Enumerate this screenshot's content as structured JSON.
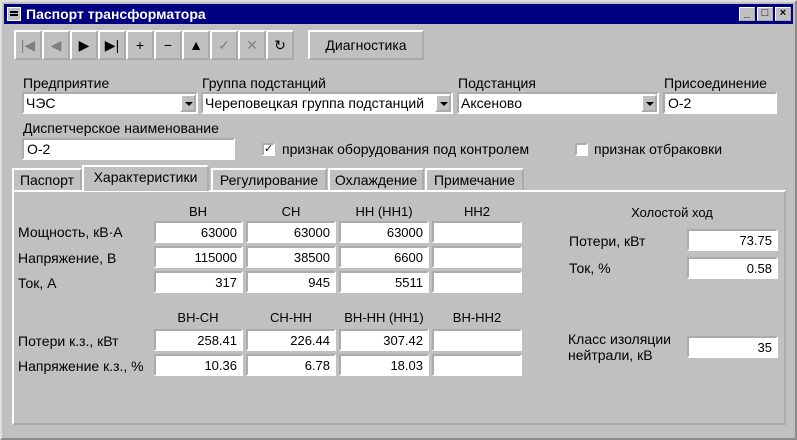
{
  "window": {
    "title": "Паспорт трансформатора"
  },
  "toolbar": {
    "first": "|◀",
    "prev": "◀",
    "next": "▶",
    "last": "▶|",
    "insert": "+",
    "delete": "−",
    "edit": "▲",
    "post": "✓",
    "cancel": "✕",
    "refresh": "↻",
    "diagnostics": "Диагностика"
  },
  "fields": {
    "enterprise_label": "Предприятие",
    "enterprise_value": "ЧЭС",
    "group_label": "Группа подстанций",
    "group_value": "Череповецкая группа подстанций",
    "substation_label": "Подстанция",
    "substation_value": "Аксеново",
    "connection_label": "Присоединение",
    "connection_value": "О-2",
    "dispatch_label": "Диспетчерское наименование",
    "dispatch_value": "О-2",
    "controlled_label": "признак оборудования под контролем",
    "controlled_checked": "✓",
    "rejected_label": "признак отбраковки"
  },
  "tabs": [
    "Паспорт",
    "Характеристики",
    "Регулирование",
    "Охлаждение",
    "Примечание"
  ],
  "characteristics": {
    "cols": [
      "ВН",
      "СН",
      "НН (НН1)",
      "НН2"
    ],
    "rows": [
      {
        "label": "Мощность, кВ·А",
        "values": [
          "63000",
          "63000",
          "63000",
          ""
        ]
      },
      {
        "label": "Напряжение, В",
        "values": [
          "115000",
          "38500",
          "6600",
          ""
        ]
      },
      {
        "label": "Ток, А",
        "values": [
          "317",
          "945",
          "5511",
          ""
        ]
      }
    ],
    "sc_cols": [
      "ВН-СН",
      "СН-НН",
      "ВН-НН (НН1)",
      "ВН-НН2"
    ],
    "sc_rows": [
      {
        "label": "Потери к.з., кВт",
        "values": [
          "258.41",
          "226.44",
          "307.42",
          ""
        ]
      },
      {
        "label": "Напряжение к.з., %",
        "values": [
          "10.36",
          "6.78",
          "18.03",
          ""
        ]
      }
    ],
    "noload_title": "Холостой ход",
    "noload_loss_label": "Потери, кВт",
    "noload_loss_value": "73.75",
    "noload_current_label": "Ток, %",
    "noload_current_value": "0.58",
    "insulation_label_1": "Класс изоляции",
    "insulation_label_2": "нейтрали, кВ",
    "insulation_value": "35"
  }
}
